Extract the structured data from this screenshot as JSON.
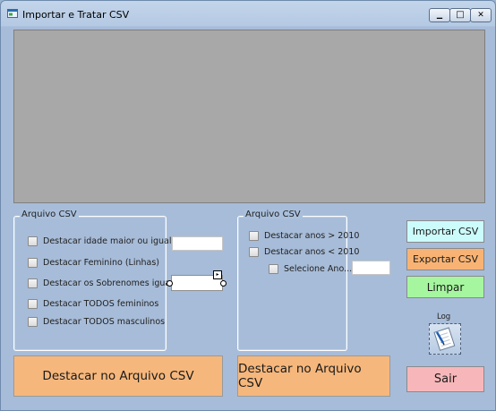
{
  "window": {
    "title": "Importar e Tratar CSV",
    "minimize_glyph": "▁",
    "maximize_glyph": "□",
    "close_glyph": "✕"
  },
  "group_left": {
    "label": "Arquivo  CSV",
    "options": [
      "Destacar idade maior ou igual a",
      "Destacar Feminino (Linhas)",
      "Destacar os Sobrenomes iguais a",
      "Destacar TODOS femininos",
      "Destacar TODOS masculinos"
    ],
    "age_input_value": "",
    "surname_select_value": "",
    "smart_tag_glyph": "▸"
  },
  "group_right": {
    "label": "Arquivo CSV",
    "options": [
      "Destacar anos > 2010",
      "Destacar anos < 2010",
      "Selecione Ano..."
    ],
    "year_input_value": ""
  },
  "buttons": {
    "import": "Importar CSV",
    "export": "Exportar CSV",
    "clear": "Limpar",
    "log_label": "Log",
    "exit": "Sair",
    "highlight_left": "Destacar no Arquivo CSV",
    "highlight_right": "Destacar no Arquivo CSV"
  },
  "colors": {
    "import_bg": "#ccfbfb",
    "export_bg": "#f8b374",
    "clear_bg": "#a6f6a0",
    "exit_bg": "#f7b7ba",
    "highlight_bg": "#f6b77c",
    "grid_bg": "#a8a8a8"
  }
}
